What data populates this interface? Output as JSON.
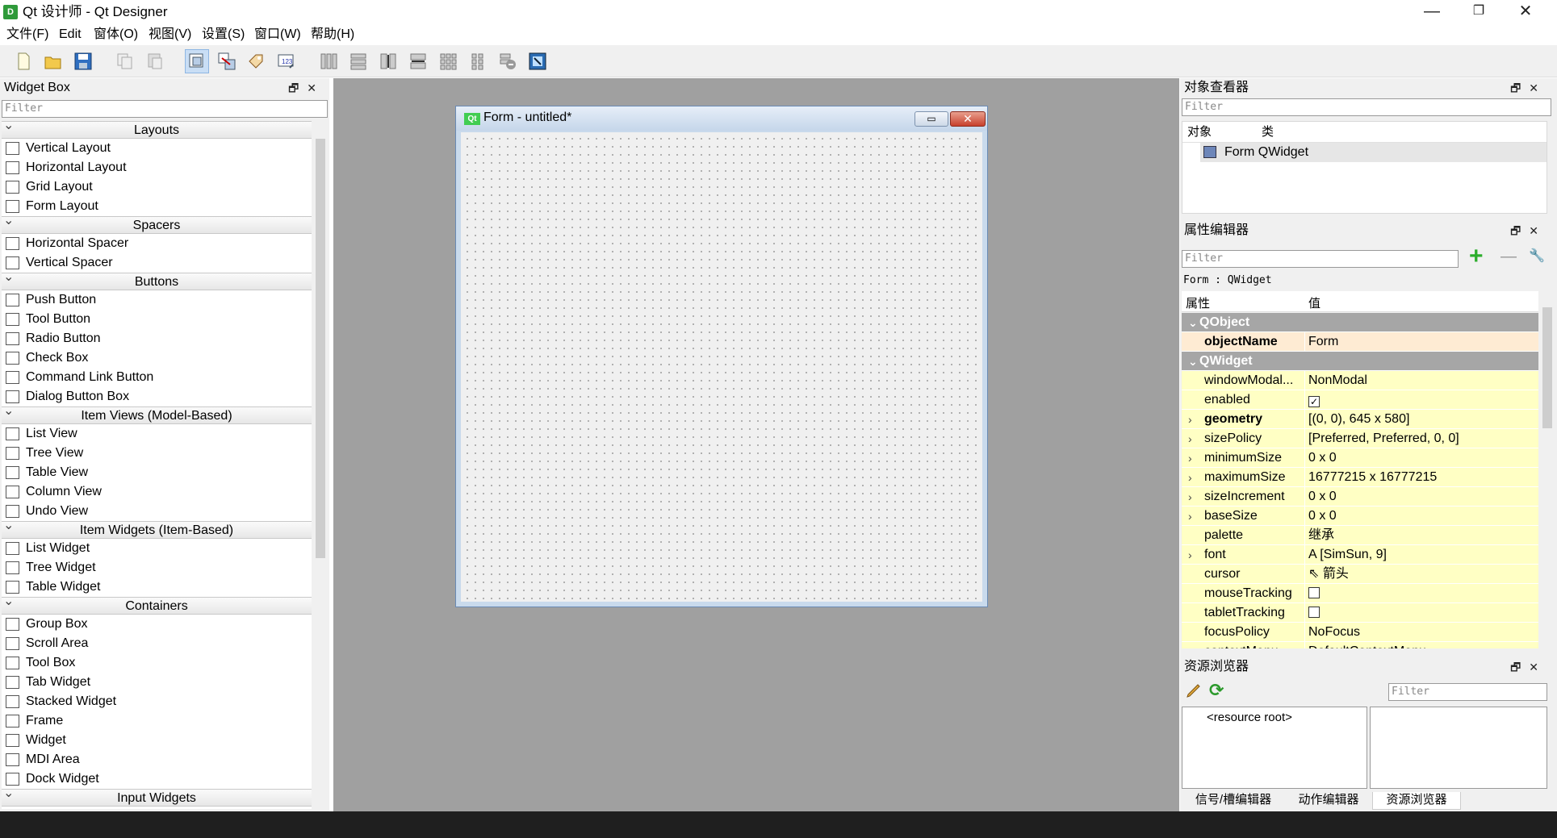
{
  "window": {
    "title": "Qt 设计师 - Qt Designer",
    "icon_label": "D",
    "minimize": "—",
    "maximize": "❐",
    "close": "✕"
  },
  "menu": [
    "文件(F)",
    "Edit",
    "窗体(O)",
    "视图(V)",
    "设置(S)",
    "窗口(W)",
    "帮助(H)"
  ],
  "toolbar_icons": [
    "new-file-icon",
    "open-folder-icon",
    "save-icon",
    "copy-icon",
    "paste-icon",
    "edit-widgets-icon",
    "edit-signals-icon",
    "edit-buddies-icon",
    "edit-tab-order-icon",
    "lay-out-horizontally-icon",
    "lay-out-vertically-icon",
    "horizontal-splitter-icon",
    "vertical-splitter-icon",
    "grid-layout-icon",
    "form-layout-icon",
    "break-layout-icon",
    "adjust-size-icon"
  ],
  "widget_box": {
    "title": "Widget Box",
    "dock_buttons": "🗗✕",
    "filter_placeholder": "Filter",
    "categories": [
      {
        "name": "Layouts",
        "items": [
          "Vertical Layout",
          "Horizontal Layout",
          "Grid Layout",
          "Form Layout"
        ]
      },
      {
        "name": "Spacers",
        "items": [
          "Horizontal Spacer",
          "Vertical Spacer"
        ]
      },
      {
        "name": "Buttons",
        "items": [
          "Push Button",
          "Tool Button",
          "Radio Button",
          "Check Box",
          "Command Link Button",
          "Dialog Button Box"
        ]
      },
      {
        "name": "Item Views (Model-Based)",
        "items": [
          "List View",
          "Tree View",
          "Table View",
          "Column View",
          "Undo View"
        ]
      },
      {
        "name": "Item Widgets (Item-Based)",
        "items": [
          "List Widget",
          "Tree Widget",
          "Table Widget"
        ]
      },
      {
        "name": "Containers",
        "items": [
          "Group Box",
          "Scroll Area",
          "Tool Box",
          "Tab Widget",
          "Stacked Widget",
          "Frame",
          "Widget",
          "MDI Area",
          "Dock Widget"
        ]
      },
      {
        "name": "Input Widgets",
        "items": []
      }
    ]
  },
  "form": {
    "qt_badge": "Qt",
    "title": "Form - untitled*",
    "min": "▭",
    "close": "✕"
  },
  "object_inspector": {
    "title": "对象查看器",
    "filter_placeholder": "Filter",
    "col_object": "对象",
    "col_class": "类",
    "row": "Form QWidget"
  },
  "property_editor": {
    "title": "属性编辑器",
    "filter_placeholder": "Filter",
    "add": "+",
    "remove": "—",
    "configure": "🔧",
    "context": "Form : QWidget",
    "col_property": "属性",
    "col_value": "值",
    "rows": [
      {
        "kind": "group",
        "name": "QObject"
      },
      {
        "kind": "prop",
        "name": "objectName",
        "value": "Form",
        "bold": true,
        "style": "o"
      },
      {
        "kind": "group",
        "name": "QWidget"
      },
      {
        "kind": "prop",
        "name": "windowModal...",
        "value": "NonModal",
        "style": "y"
      },
      {
        "kind": "prop",
        "name": "enabled",
        "value": "✓",
        "checkbox": true,
        "style": "y"
      },
      {
        "kind": "prop",
        "name": "geometry",
        "value": "[(0, 0), 645 x 580]",
        "bold": true,
        "expand": true,
        "style": "y"
      },
      {
        "kind": "prop",
        "name": "sizePolicy",
        "value": "[Preferred, Preferred, 0, 0]",
        "expand": true,
        "style": "y"
      },
      {
        "kind": "prop",
        "name": "minimumSize",
        "value": "0 x 0",
        "expand": true,
        "style": "y"
      },
      {
        "kind": "prop",
        "name": "maximumSize",
        "value": "16777215 x 16777215",
        "expand": true,
        "style": "y"
      },
      {
        "kind": "prop",
        "name": "sizeIncrement",
        "value": "0 x 0",
        "expand": true,
        "style": "y"
      },
      {
        "kind": "prop",
        "name": "baseSize",
        "value": "0 x 0",
        "expand": true,
        "style": "y"
      },
      {
        "kind": "prop",
        "name": "palette",
        "value": "继承",
        "style": "y"
      },
      {
        "kind": "prop",
        "name": "font",
        "value": "A  [SimSun, 9]",
        "expand": true,
        "style": "y"
      },
      {
        "kind": "prop",
        "name": "cursor",
        "value": "⇖  箭头",
        "style": "y"
      },
      {
        "kind": "prop",
        "name": "mouseTracking",
        "value": "",
        "checkbox": true,
        "style": "y"
      },
      {
        "kind": "prop",
        "name": "tabletTracking",
        "value": "",
        "checkbox": true,
        "style": "y"
      },
      {
        "kind": "prop",
        "name": "focusPolicy",
        "value": "NoFocus",
        "style": "y"
      },
      {
        "kind": "prop",
        "name": "contextMenu...",
        "value": "DefaultContextMenu",
        "style": "y"
      }
    ]
  },
  "resource_browser": {
    "title": "资源浏览器",
    "filter_placeholder": "Filter",
    "root": "<resource root>",
    "tabs": [
      "信号/槽编辑器",
      "动作编辑器",
      "资源浏览器"
    ]
  },
  "colors": {
    "accent": "#c9def5",
    "group_bg": "#a6a6a6",
    "prop_yellow": "#ffffc4",
    "prop_orange": "#feebd3",
    "mdi_bg": "#a0a0a0"
  }
}
